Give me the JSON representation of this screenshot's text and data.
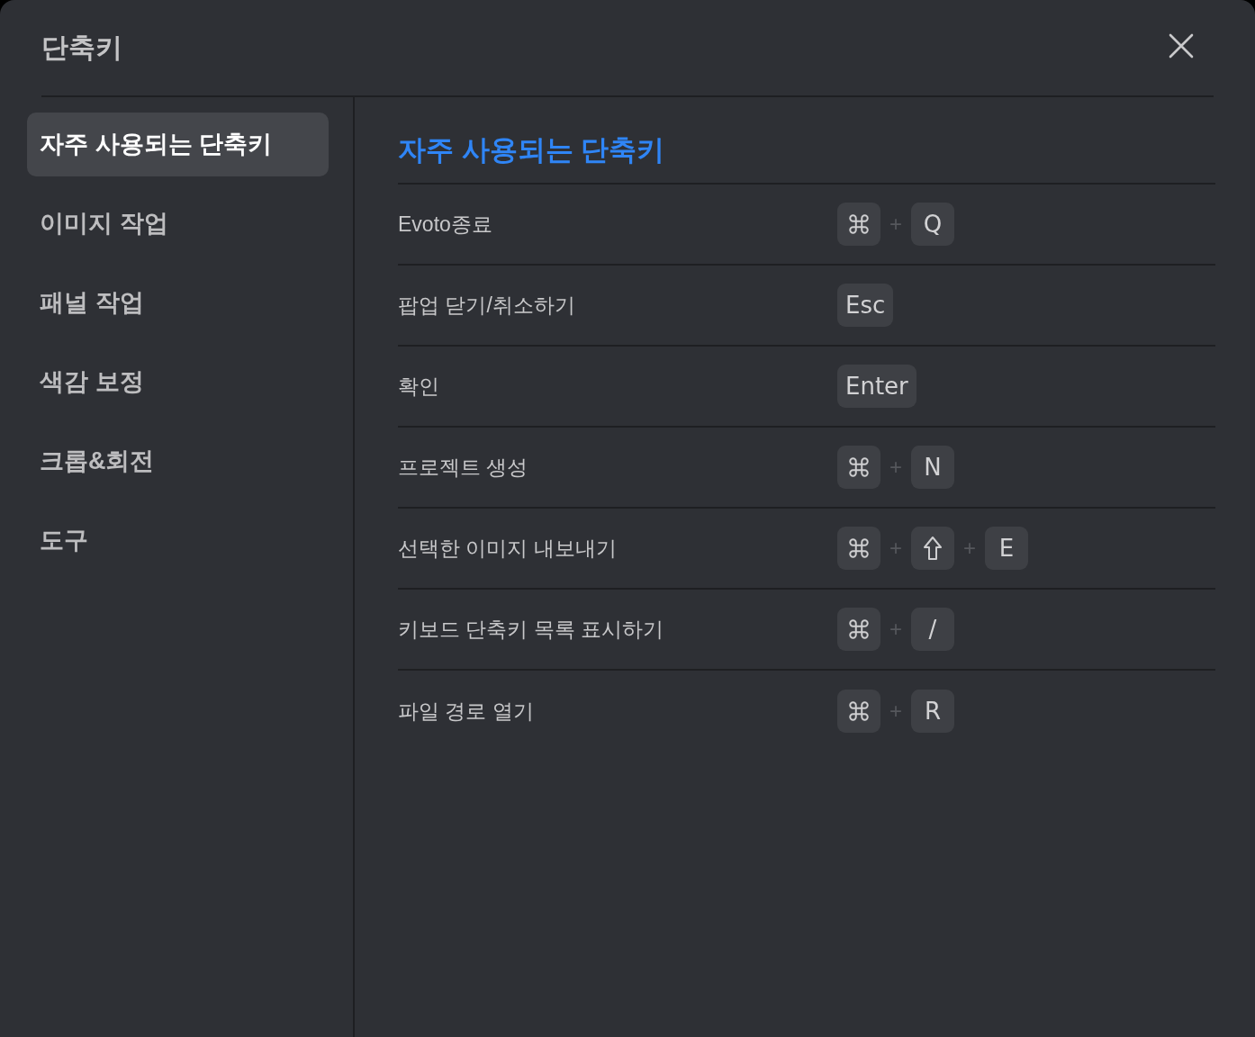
{
  "window": {
    "title": "단축키"
  },
  "sidebar": {
    "items": [
      {
        "label": "자주 사용되는 단축키",
        "selected": true
      },
      {
        "label": "이미지 작업",
        "selected": false
      },
      {
        "label": "패널 작업",
        "selected": false
      },
      {
        "label": "색감 보정",
        "selected": false
      },
      {
        "label": "크롭&회전",
        "selected": false
      },
      {
        "label": "도구",
        "selected": false
      }
    ]
  },
  "content": {
    "heading": "자주 사용되는 단축키",
    "shortcuts": [
      {
        "label": "Evoto종료",
        "keys": [
          {
            "kind": "command_key"
          },
          {
            "kind": "separator",
            "label": "+"
          },
          {
            "kind": "key",
            "label": "Q"
          }
        ]
      },
      {
        "label": "팝업 닫기/취소하기",
        "keys": [
          {
            "kind": "key",
            "label": "Esc"
          }
        ]
      },
      {
        "label": "확인",
        "keys": [
          {
            "kind": "key",
            "label": "Enter"
          }
        ]
      },
      {
        "label": "프로젝트 생성",
        "keys": [
          {
            "kind": "command_key"
          },
          {
            "kind": "separator",
            "label": "+"
          },
          {
            "kind": "key",
            "label": "N"
          }
        ]
      },
      {
        "label": "선택한 이미지 내보내기",
        "keys": [
          {
            "kind": "command_key"
          },
          {
            "kind": "separator",
            "label": "+"
          },
          {
            "kind": "shift_key"
          },
          {
            "kind": "separator",
            "label": "+"
          },
          {
            "kind": "key",
            "label": "E"
          }
        ]
      },
      {
        "label": "키보드 단축키 목록 표시하기",
        "keys": [
          {
            "kind": "command_key"
          },
          {
            "kind": "separator",
            "label": "+"
          },
          {
            "kind": "key",
            "label": "/"
          }
        ]
      },
      {
        "label": "파일 경로 열기",
        "keys": [
          {
            "kind": "command_key"
          },
          {
            "kind": "separator",
            "label": "+"
          },
          {
            "kind": "key",
            "label": "R"
          }
        ]
      }
    ]
  }
}
